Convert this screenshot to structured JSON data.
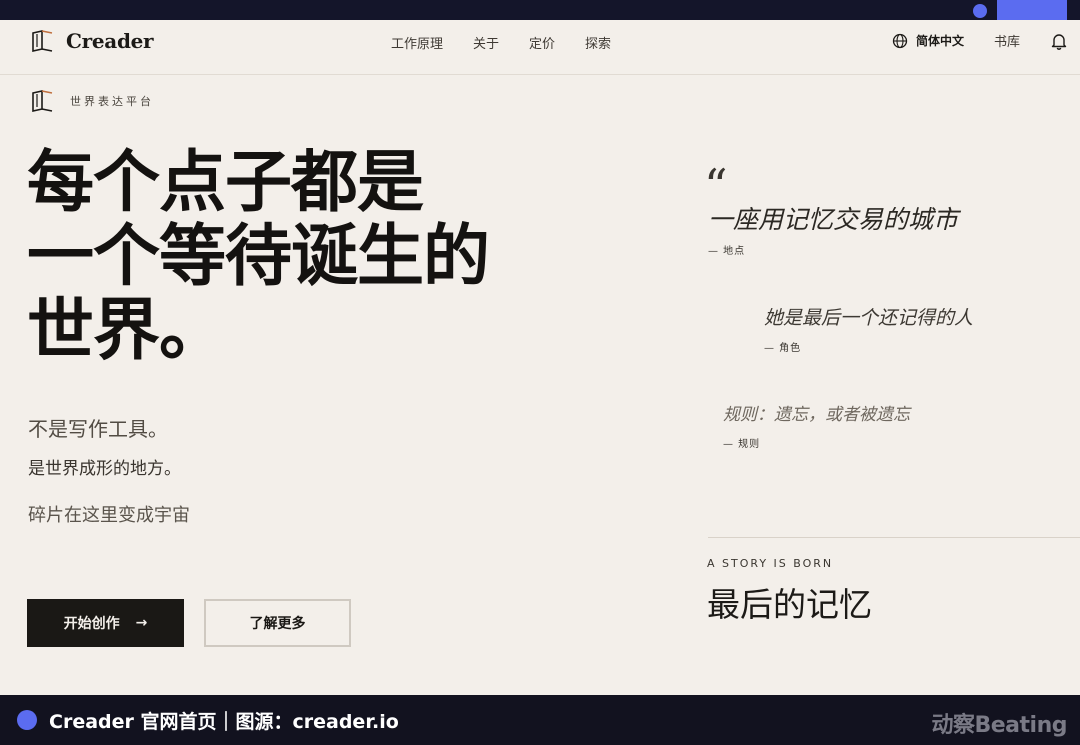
{
  "nav": {
    "brand_name": "Creader",
    "links": [
      "工作原理",
      "关于",
      "定价",
      "探索"
    ],
    "language": "简体中文",
    "library": "书库"
  },
  "sub_brand": {
    "label": "世界表达平台"
  },
  "hero": {
    "lines": [
      "每个点子都是",
      "一个等待诞生的",
      "世界。"
    ]
  },
  "taglines": {
    "line1": "不是写作工具。",
    "line2": "是世界成形的地方。",
    "line3": "碎片在这里变成宇宙"
  },
  "buttons": {
    "primary": "开始创作",
    "primary_arrow": "→",
    "secondary": "了解更多"
  },
  "quotes": {
    "mark": "“",
    "items": [
      {
        "text": "一座用记忆交易的城市",
        "attr": "— 地点"
      },
      {
        "text": "她是最后一个还记得的人",
        "attr": "— 角色"
      },
      {
        "text": "规则：遗忘，或者被遗忘",
        "attr": "— 规则"
      }
    ]
  },
  "story": {
    "kicker": "A STORY IS BORN",
    "title": "最后的记忆"
  },
  "caption": {
    "text": "Creader 官网首页｜图源：creader.io",
    "watermark": "动察Beating"
  },
  "colors": {
    "background": "#f3efea",
    "ink": "#1c1a17",
    "accent": "#5b6cf0",
    "caption_bg": "#12121f"
  }
}
